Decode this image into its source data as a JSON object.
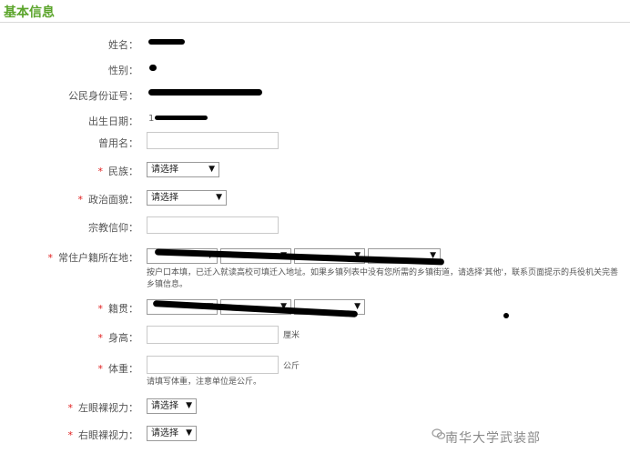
{
  "section": {
    "title": "基本信息"
  },
  "fields": {
    "name": {
      "label": "姓名："
    },
    "gender": {
      "label": "性别："
    },
    "id_number": {
      "label": "公民身份证号："
    },
    "birth_date": {
      "label": "出生日期：",
      "value_partial": "1"
    },
    "former_name": {
      "label": "曾用名：",
      "value": ""
    },
    "ethnicity": {
      "required": "*",
      "label": "民族：",
      "selected": "请选择"
    },
    "political_status": {
      "required": "*",
      "label": "政治面貌：",
      "selected": "请选择"
    },
    "religion": {
      "label": "宗教信仰：",
      "value": ""
    },
    "registered_residence": {
      "required": "*",
      "label": "常住户籍所在地：",
      "hint": "按户口本填，已迁入就读高校可填迁入地址。如果乡镇列表中没有您所需的乡镇街道，请选择'其他'，联系页面提示的兵役机关完善乡镇信息。"
    },
    "native_place": {
      "required": "*",
      "label": "籍贯："
    },
    "height": {
      "required": "*",
      "label": "身高：",
      "value": "",
      "unit": "厘米"
    },
    "weight": {
      "required": "*",
      "label": "体重：",
      "value": "",
      "unit": "公斤",
      "hint": "请填写体重，注意单位是公斤。"
    },
    "left_eye": {
      "required": "*",
      "label": "左眼裸视力：",
      "selected": "请选择"
    },
    "right_eye": {
      "required": "*",
      "label": "右眼裸视力：",
      "selected": "请选择"
    }
  },
  "watermark": {
    "text": "南华大学武装部",
    "icon": "wechat-icon"
  }
}
